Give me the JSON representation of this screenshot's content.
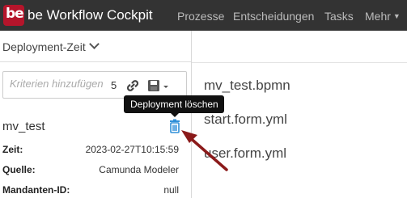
{
  "header": {
    "logo_text": "be",
    "brand": "be Workflow Cockpit",
    "nav": [
      {
        "label": "Prozesse"
      },
      {
        "label": "Entscheidungen"
      },
      {
        "label": "Tasks"
      },
      {
        "label": "Mehr"
      }
    ]
  },
  "sidebar": {
    "sort_label": "Deployment-Zeit",
    "search": {
      "placeholder": "Kriterien hinzufügen",
      "result_count": "5"
    },
    "deployment": {
      "name": "mv_test",
      "delete_tooltip": "Deployment löschen",
      "properties": [
        {
          "label": "Zeit:",
          "value": "2023-02-27T10:15:59"
        },
        {
          "label": "Quelle:",
          "value": "Camunda Modeler"
        },
        {
          "label": "Mandanten-ID:",
          "value": "null"
        }
      ]
    }
  },
  "main": {
    "resources": [
      {
        "name": "mv_test.bpmn"
      },
      {
        "name": "start.form.yml"
      },
      {
        "name": "user.form.yml"
      }
    ]
  },
  "colors": {
    "topbar": "#333333",
    "logo": "#b5152b",
    "delete_icon": "#2f8fd8",
    "annotation_arrow": "#8b1a1a"
  },
  "icons": {
    "link": "link-icon",
    "save": "save-icon",
    "delete": "trash-icon",
    "sort": "chevron-down-icon"
  }
}
